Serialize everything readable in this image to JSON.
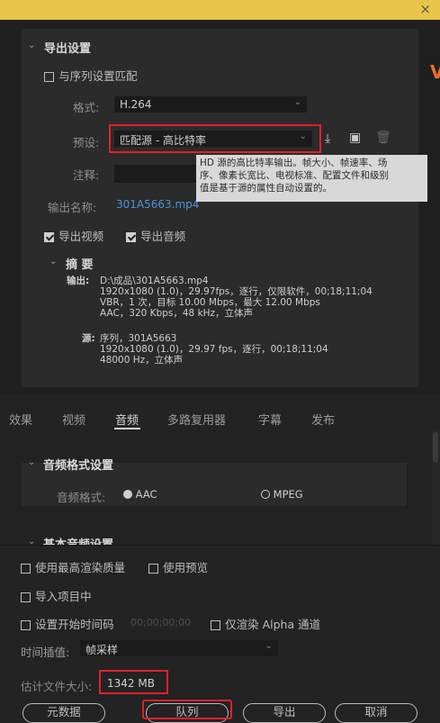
{
  "window": {
    "close_label": "×"
  },
  "export": {
    "section_title": "导出设置",
    "match_sequence_label": "与序列设置匹配",
    "format_label": "格式:",
    "format_value": "H.264",
    "preset_label": "预设:",
    "preset_value": "匹配源 - 高比特率",
    "comment_label": "注释:",
    "output_name_label": "输出名称:",
    "output_name_value": "301A5663.mp4",
    "export_video_label": "导出视频",
    "export_audio_label": "导出音频",
    "tooltip_lines": [
      "HD 源的高比特率输出。帧大小、帧速率、场",
      "序、像素长宽比、电视标准、配置文件和级别",
      "值是基于源的属性自动设置的。"
    ]
  },
  "summary": {
    "title": "摘 要",
    "output_label": "输出:",
    "output_lines": [
      "D:\\成品\\301A5663.mp4",
      "1920x1080 (1.0)，29.97fps，逐行，仅限软件，00;18;11;04",
      "VBR，1 次，目标 10.00 Mbps，最大 12.00 Mbps",
      "AAC，320 Kbps，48  kHz，立体声"
    ],
    "source_label": "源:",
    "source_lines": [
      "序列，301A5663",
      "1920x1080 (1.0)，29.97 fps，逐行，00;18;11;04",
      "48000 Hz，立体声"
    ]
  },
  "tabs": [
    {
      "label": "效果"
    },
    {
      "label": "视频"
    },
    {
      "label": "音频"
    },
    {
      "label": "多路复用器"
    },
    {
      "label": "字幕"
    },
    {
      "label": "发布"
    }
  ],
  "audio": {
    "format_settings_title": "音频格式设置",
    "audio_format_label": "音频格式:",
    "option_aac": "AAC",
    "option_mpeg": "MPEG",
    "basic_settings_title": "基本音频设置"
  },
  "options": {
    "max_render_quality": "使用最高渲染质量",
    "use_previews": "使用预览",
    "import_into_project": "导入项目中",
    "set_start_timecode": "设置开始时间码",
    "start_timecode_value": "00;00;00;00",
    "render_alpha_only": "仅渲染 Alpha 通道",
    "time_interpolation_label": "时间插值:",
    "time_interpolation_value": "帧采样",
    "estimated_size_label": "估计文件大小:",
    "estimated_size_value": "1342 MB"
  },
  "buttons": {
    "metadata": "元数据",
    "queue": "队列",
    "export": "导出",
    "cancel": "取消"
  },
  "icons": [
    "chevron-down-icon",
    "save-preset-icon",
    "import-preset-icon",
    "delete-preset-icon",
    "close-icon",
    "dropdown-arrow-icon"
  ]
}
